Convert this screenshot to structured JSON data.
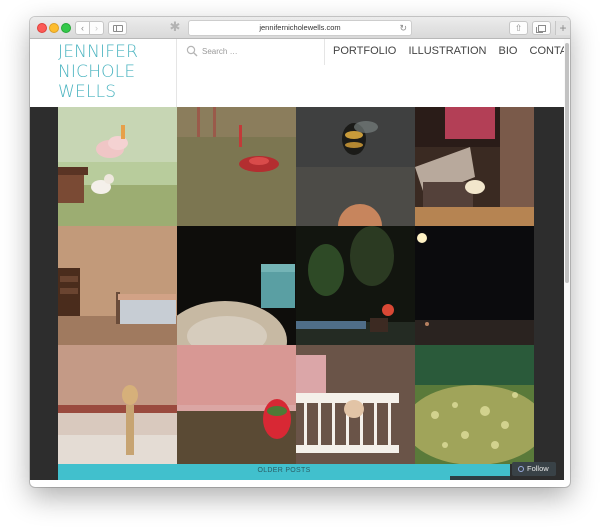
{
  "browser": {
    "url": "jennifernicholewells.com",
    "back_icon": "‹",
    "forward_icon": "›",
    "reload_icon": "↻",
    "share_icon": "⇧",
    "new_tab_icon": "+",
    "extension_icon": "✱"
  },
  "site": {
    "title_lines": [
      "JENNIFER",
      "NICHOLE",
      "WELLS"
    ],
    "accent_color": "#4bb4c0"
  },
  "search": {
    "placeholder": "Search …"
  },
  "nav": {
    "items": [
      "PORTFOLIO",
      "ILLUSTRATION",
      "BIO",
      "CONTACT"
    ]
  },
  "gallery": {
    "tiles": [
      "toy-poodle-cloud",
      "red-toy-spinner-on-grass",
      "bee-on-gravel",
      "house-at-night",
      "dollhouse-bedroom",
      "rock-and-mug",
      "figure-by-pool",
      "night-lamp-figure",
      "figurine-at-shelves",
      "strawberry-on-pink",
      "baby-crib",
      "yellow-beads"
    ]
  },
  "footer": {
    "older_posts": "OLDER POSTS",
    "follow": "Follow"
  }
}
